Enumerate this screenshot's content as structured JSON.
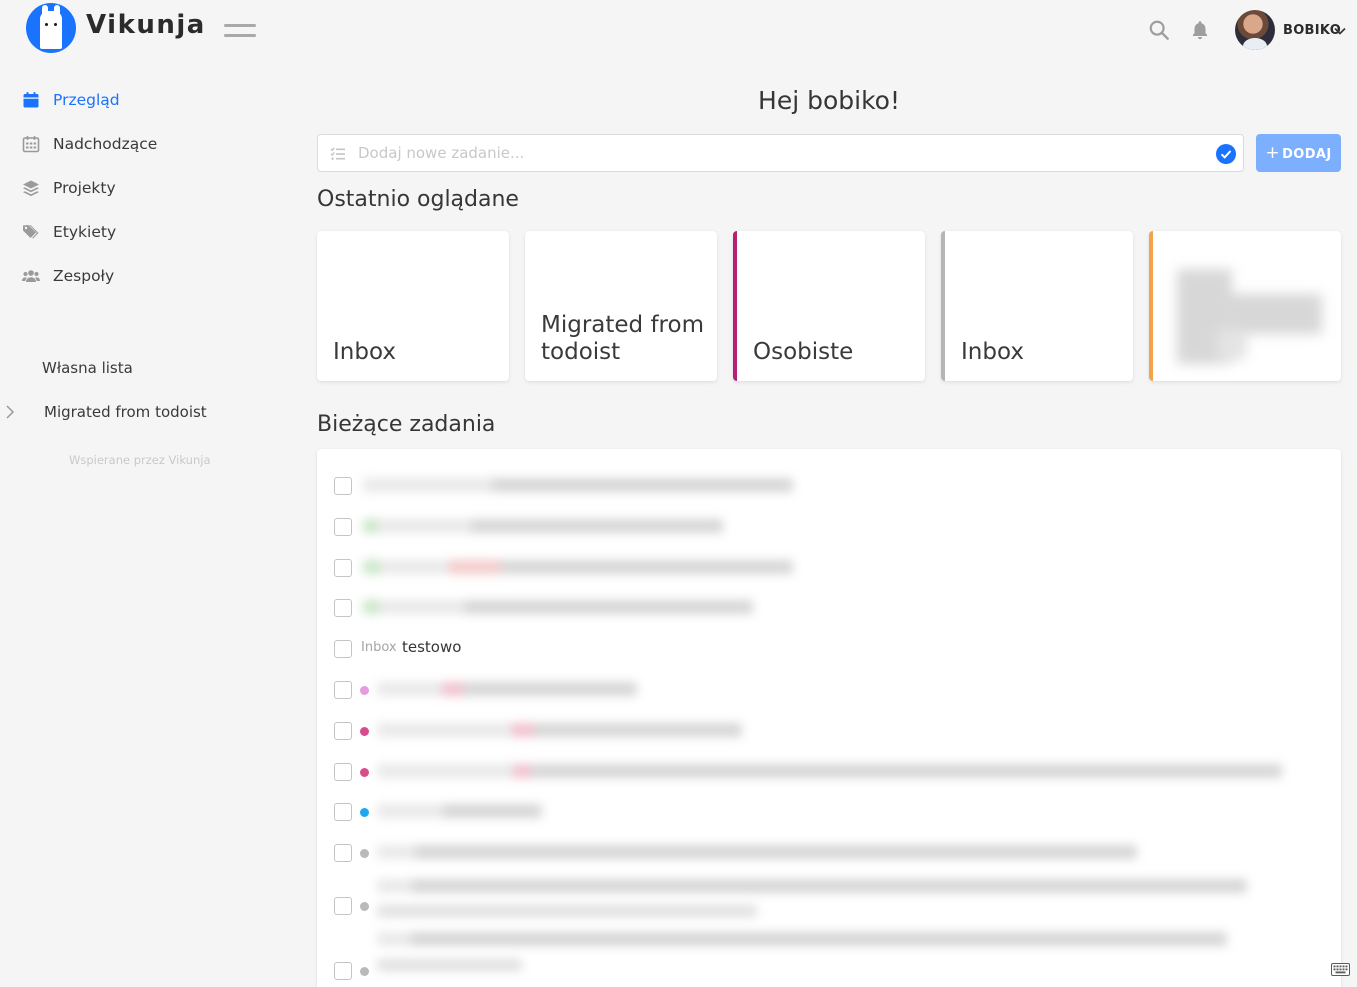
{
  "header": {
    "brand": "Vikunja",
    "username": "BOBIKO"
  },
  "sidebar": {
    "items": [
      {
        "label": "Przegląd",
        "icon": "calendar-icon",
        "active": true
      },
      {
        "label": "Nadchodzące",
        "icon": "calendar-grid-icon",
        "active": false
      },
      {
        "label": "Projekty",
        "icon": "layers-icon",
        "active": false
      },
      {
        "label": "Etykiety",
        "icon": "tags-icon",
        "active": false
      },
      {
        "label": "Zespoły",
        "icon": "users-icon",
        "active": false
      }
    ],
    "lists": [
      {
        "label": "Własna lista"
      },
      {
        "label": "Migrated from todoist"
      }
    ],
    "powered_by": "Wspierane przez Vikunja"
  },
  "main": {
    "greeting": "Hej bobiko!",
    "add_task": {
      "placeholder": "Dodaj nowe zadanie...",
      "button_label": "DODAJ",
      "button_icon": "plus-icon"
    },
    "recent_title": "Ostatnio oglądane",
    "recent": [
      {
        "title": "Inbox",
        "color": ""
      },
      {
        "title": "Migrated from todoist",
        "color": ""
      },
      {
        "title": "Osobiste",
        "color": "#b71e74"
      },
      {
        "title": "Inbox",
        "color": "#b5b5b5"
      },
      {
        "title": "",
        "color": "#f5a34a"
      }
    ],
    "current_title": "Bieżące zadania",
    "tasks": {
      "visible_task": {
        "project": "Inbox",
        "title": "testowo"
      },
      "dot_colors": [
        "#e69ae0",
        "#d94b8c",
        "#d94b8c",
        "#1ea7f0",
        "#b9b9b9",
        "#b9b9b9",
        "#b9b9b9"
      ]
    }
  },
  "colors": {
    "accent": "#1973ff",
    "add_button": "#7cb0ff"
  }
}
